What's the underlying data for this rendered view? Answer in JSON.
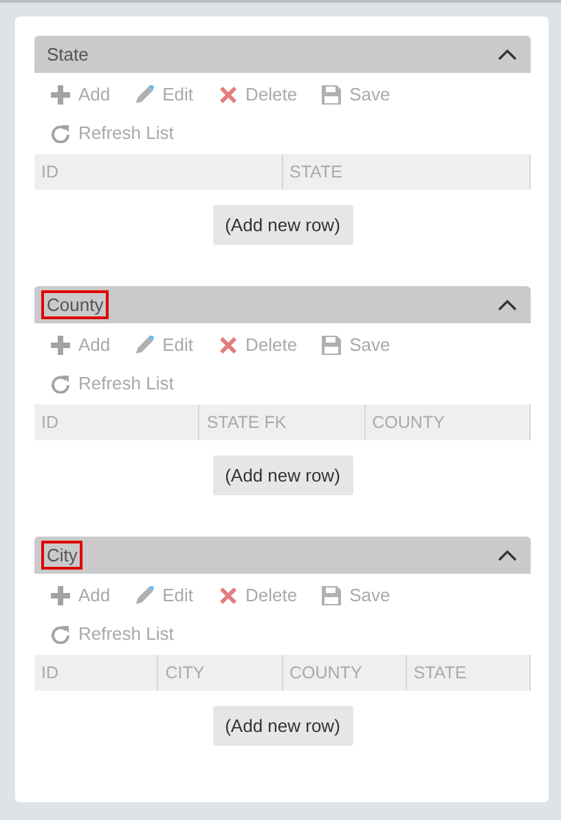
{
  "panels": [
    {
      "title": "State",
      "highlighted": false,
      "expanded": true,
      "tools": [
        {
          "kind": "add",
          "label": "Add",
          "disabled": true
        },
        {
          "kind": "edit",
          "label": "Edit",
          "disabled": true
        },
        {
          "kind": "delete",
          "label": "Delete",
          "disabled": true
        },
        {
          "kind": "save",
          "label": "Save",
          "disabled": true
        },
        {
          "kind": "refresh",
          "label": "Refresh List",
          "disabled": true
        }
      ],
      "columns": [
        "ID",
        "STATE"
      ],
      "add_row": "(Add new row)"
    },
    {
      "title": "County",
      "highlighted": true,
      "expanded": true,
      "tools": [
        {
          "kind": "add",
          "label": "Add",
          "disabled": true
        },
        {
          "kind": "edit",
          "label": "Edit",
          "disabled": true
        },
        {
          "kind": "delete",
          "label": "Delete",
          "disabled": true
        },
        {
          "kind": "save",
          "label": "Save",
          "disabled": true
        },
        {
          "kind": "refresh",
          "label": "Refresh List",
          "disabled": true
        }
      ],
      "columns": [
        "ID",
        "STATE FK",
        "COUNTY"
      ],
      "add_row": "(Add new row)"
    },
    {
      "title": "City",
      "highlighted": true,
      "expanded": true,
      "tools": [
        {
          "kind": "add",
          "label": "Add",
          "disabled": true
        },
        {
          "kind": "edit",
          "label": "Edit",
          "disabled": true
        },
        {
          "kind": "delete",
          "label": "Delete",
          "disabled": true
        },
        {
          "kind": "save",
          "label": "Save",
          "disabled": true
        },
        {
          "kind": "refresh",
          "label": "Refresh List",
          "disabled": true
        }
      ],
      "columns": [
        "ID",
        "CITY",
        "COUNTY",
        "STATE"
      ],
      "add_row": "(Add new row)"
    }
  ]
}
